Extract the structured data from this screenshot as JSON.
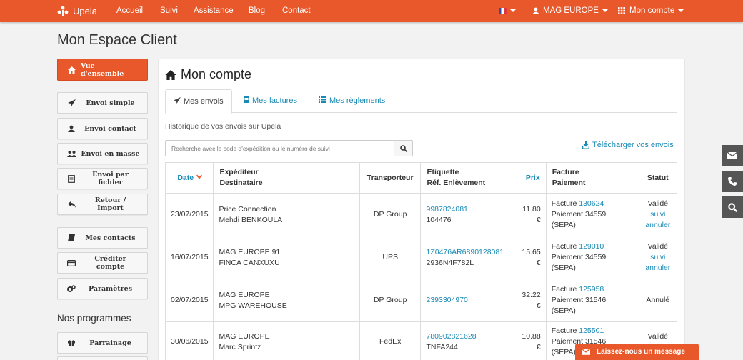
{
  "topnav": {
    "brand": "Upela",
    "links": [
      "Accueil",
      "Suivi",
      "Assistance",
      "Blog",
      "Contact"
    ],
    "user": "MAG EUROPE",
    "account": "Mon compte"
  },
  "page_title": "Mon Espace Client",
  "sidebar": {
    "overview": "Vue d'ensemble",
    "group1": [
      "Envoi simple",
      "Envoi contact",
      "Envoi en masse",
      "Envoi par fichier",
      "Retour / Import"
    ],
    "group2": [
      "Mes contacts",
      "Créditer compte",
      "Paramètres"
    ],
    "programs_heading": "Nos programmes",
    "programs": [
      "Parrainage"
    ]
  },
  "panel": {
    "title": "Mon compte",
    "tabs": [
      "Mes envois",
      "Mes factures",
      "Mes règlements"
    ],
    "history_label": "Historique de vos envois sur Upela",
    "search_placeholder": "Recherche avec le code d'expédition ou le numéro de suivi",
    "download_link": "Télécharger vos envois"
  },
  "table": {
    "headers": {
      "date": "Date",
      "sender": "Expéditeur",
      "recipient": "Destinataire",
      "carrier": "Transporteur",
      "label": "Etiquette",
      "pickup_ref": "Réf. Enlèvement",
      "price": "Prix",
      "invoice": "Facture",
      "payment": "Paiement",
      "status": "Statut"
    },
    "rows": [
      {
        "date": "23/07/2015",
        "sender": "Price Connection",
        "recipient": "Mehdi BENKOULA",
        "carrier": "DP Group",
        "label": "9987824081",
        "ref": "104476",
        "price": "11.80 €",
        "invoice_prefix": "Facture",
        "invoice": "130624",
        "payment": "Paiement 34559",
        "method": "(SEPA)",
        "status": "Validé",
        "actions": [
          "suivi",
          "annuler"
        ]
      },
      {
        "date": "16/07/2015",
        "sender": "MAG EUROPE 91",
        "recipient": "FINCA CANXUXU",
        "carrier": "UPS",
        "label": "1Z0476AR6890128081",
        "ref": "2936N4F782L",
        "price": "15.65 €",
        "invoice_prefix": "Facture",
        "invoice": "129010",
        "payment": "Paiement 34559",
        "method": "(SEPA)",
        "status": "Validé",
        "actions": [
          "suivi",
          "annuler"
        ]
      },
      {
        "date": "02/07/2015",
        "sender": "MAG EUROPE",
        "recipient": "MPG WAREHOUSE",
        "carrier": "DP Group",
        "label": "2393304970",
        "ref": "",
        "price": "32.22 €",
        "invoice_prefix": "Facture",
        "invoice": "125958",
        "payment": "Paiement 31546",
        "method": "(SEPA)",
        "status": "Annulé",
        "actions": []
      },
      {
        "date": "30/06/2015",
        "sender": "MAG EUROPE",
        "recipient": "Marc Sprintz",
        "carrier": "FedEx",
        "label": "780902821628",
        "ref": "TNFA244",
        "price": "10.88 €",
        "invoice_prefix": "Facture",
        "invoice": "125501",
        "payment": "Paiement 31546",
        "method": "(SEPA)",
        "status": "Validé",
        "actions": [
          "suivi"
        ]
      }
    ]
  },
  "message_bar": "Laissez-nous un message",
  "colors": {
    "brand": "#e8582a",
    "link": "#1a8ab5",
    "float": "#555555"
  }
}
